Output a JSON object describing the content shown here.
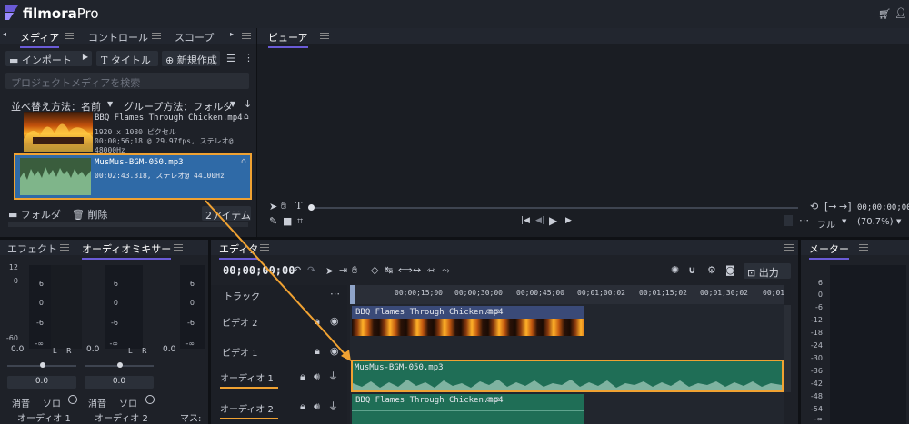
{
  "app": {
    "brand": "filmora",
    "brand_suffix": "Pro"
  },
  "media_panel": {
    "tabs": [
      "メディア",
      "コントロール",
      "スコープ"
    ],
    "toolbar": {
      "import": "インポート",
      "title": "タイトル",
      "new": "新規作成"
    },
    "search_placeholder": "プロジェクトメディアを検索",
    "sort": "並べ替え方法：名前",
    "group": "グループ方法：フォルダ",
    "items": [
      {
        "name": "BBQ Flames Through Chicken.mp4",
        "info1": "1920 x 1080 ピクセル",
        "info2": "00;00;56;18 @ 29.97fps, ステレオ@ 48000Hz"
      },
      {
        "name": "MusMus-BGM-050.mp3",
        "info1": "00:02:43.318, ステレオ@ 44100Hz",
        "info2": ""
      }
    ],
    "footer": {
      "folder": "フォルダ",
      "delete": "削除",
      "count": "2アイテム"
    }
  },
  "viewer": {
    "tab": "ビューア",
    "timecode": "00;00;00;00",
    "mode": "フル",
    "zoom": "(70.7%)"
  },
  "effects_panel": {
    "tabs": [
      "エフェクト",
      "オーディオミキサー"
    ],
    "scale": [
      "12",
      "6",
      "0",
      "-6",
      "-∞",
      "-60"
    ],
    "channels": [
      {
        "level": "0.0",
        "pan": "0.0",
        "mute": "消音",
        "solo": "ソロ",
        "name": "オーディオ 1"
      },
      {
        "level": "0.0",
        "pan": "0.0",
        "mute": "消音",
        "solo": "ソロ",
        "name": "オーディオ 2"
      }
    ],
    "master": "マス:",
    "lr": [
      "L",
      "R"
    ]
  },
  "editor": {
    "tab": "エディタ",
    "timecode": "00;00;00;00",
    "export": "出力",
    "track_header": "トラック",
    "ruler": [
      "00;00;15;00",
      "00;00;30;00",
      "00;00;45;00",
      "00;01;00;02",
      "00;01;15;02",
      "00;01;30;02",
      "00;01"
    ],
    "tracks": [
      {
        "name": "ビデオ 2"
      },
      {
        "name": "ビデオ 1"
      },
      {
        "name": "オーディオ 1"
      },
      {
        "name": "オーディオ 2"
      }
    ],
    "clips": {
      "video2": "BBQ Flames Through Chicken.mp4",
      "audio1": "MusMus-BGM-050.mp3",
      "audio2": "BBQ Flames Through Chicken.mp4"
    }
  },
  "meter_panel": {
    "tab": "メーター",
    "scale": [
      "6",
      "0",
      "-6",
      "-12",
      "-18",
      "-24",
      "-30",
      "-36",
      "-42",
      "-48",
      "-54",
      "-∞"
    ]
  },
  "colors": {
    "accent": "#6a5bd6",
    "highlight": "#f0a232",
    "clip_video": "#3a4a78",
    "clip_audio": "#1f6e56"
  }
}
